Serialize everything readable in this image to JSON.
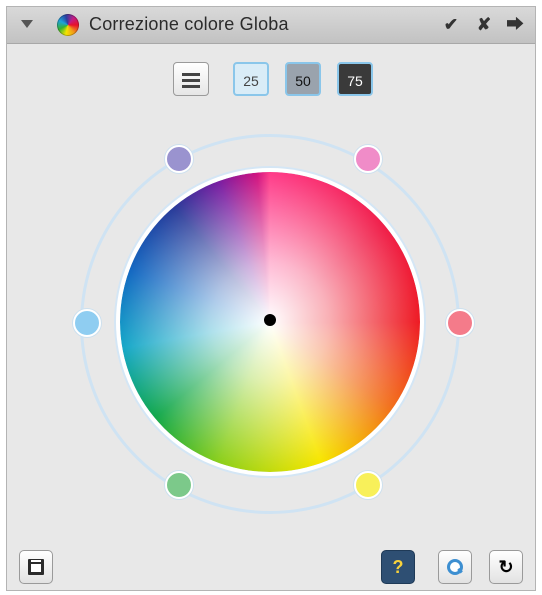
{
  "window": {
    "title": "Correzione colore Globa"
  },
  "titlebar_buttons": {
    "confirm": "✔",
    "close": "✘",
    "detach": "⮕"
  },
  "presets": {
    "p25": "25",
    "p50": "50",
    "p75": "75"
  },
  "handles": [
    {
      "name": "purple",
      "color": "#9a93cf"
    },
    {
      "name": "pink",
      "color": "#f08cc8"
    },
    {
      "name": "red",
      "color": "#f47b8a"
    },
    {
      "name": "yellow",
      "color": "#f8f05a"
    },
    {
      "name": "green",
      "color": "#7cc98a"
    },
    {
      "name": "blue",
      "color": "#8fcdf1"
    }
  ],
  "bottom": {
    "help": "?",
    "refresh": "↻"
  }
}
